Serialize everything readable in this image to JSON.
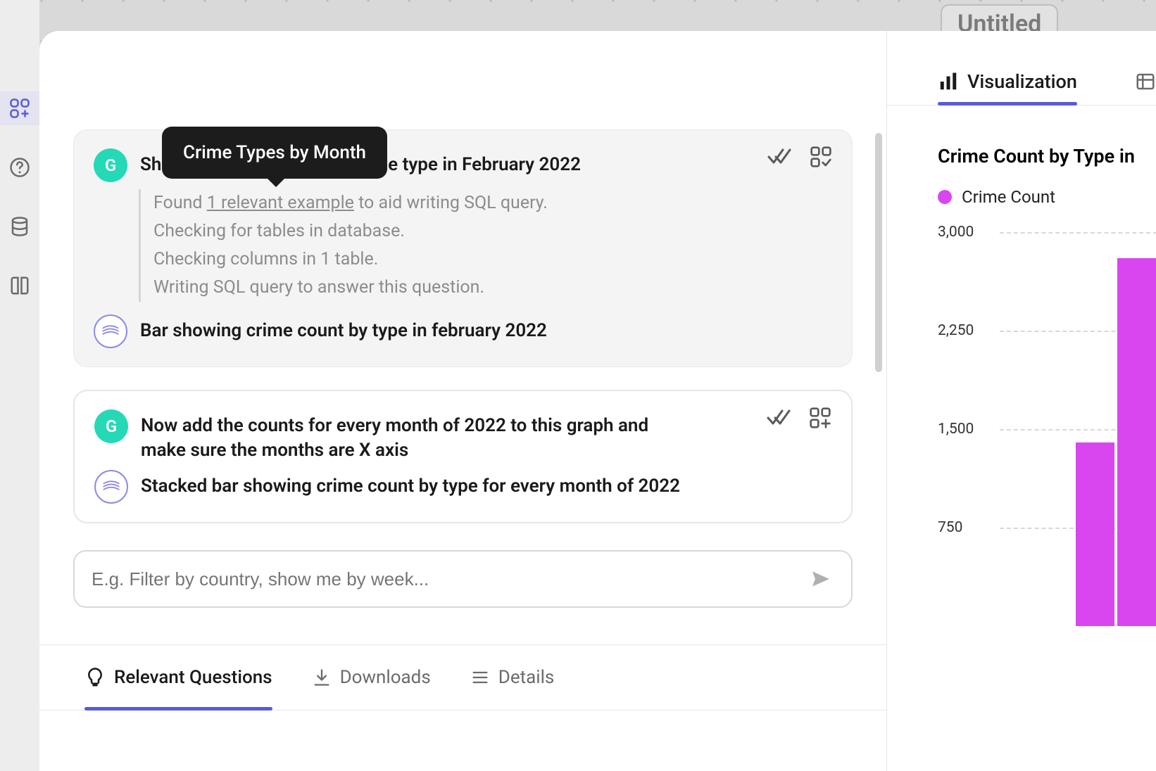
{
  "canvas": {
    "title": "Untitled"
  },
  "tooltip": "Crime Types by Month",
  "sidebar": {
    "items": [
      {
        "name": "apps-icon"
      },
      {
        "name": "help-icon"
      },
      {
        "name": "database-icon"
      },
      {
        "name": "docs-icon"
      }
    ]
  },
  "conversations": [
    {
      "user_initial": "G",
      "user_msg_prefix": "Sh",
      "user_msg_suffix": "crime type in February 2022",
      "steps_prefix": "Found ",
      "steps_link": "1 relevant example",
      "steps_suffix": " to aid writing SQL query.",
      "step2": "Checking for tables in database.",
      "step3": "Checking columns in 1 table.",
      "step4": "Writing SQL query to answer this question.",
      "ai_msg": "Bar showing crime count by type in february 2022"
    },
    {
      "user_initial": "G",
      "user_msg": "Now add the counts for every month of 2022 to this graph and make sure the months are X axis",
      "ai_msg": "Stacked bar showing crime count by type for every month of 2022"
    }
  ],
  "query_input": {
    "placeholder": "E.g. Filter by country, show me by week..."
  },
  "bottom_tabs": {
    "relevant": "Relevant Questions",
    "downloads": "Downloads",
    "details": "Details"
  },
  "vis_tabs": {
    "visualization": "Visualization"
  },
  "chart": {
    "title": "Crime Count by Type in",
    "legend": "Crime Count",
    "y_ticks": [
      "3,000",
      "2,250",
      "1,500",
      "750"
    ]
  },
  "chart_data": {
    "type": "bar",
    "title": "Crime Count by Type in",
    "ylabel": "Crime Count",
    "ylim": [
      0,
      3000
    ],
    "legend_position": "top-left",
    "series": [
      {
        "name": "Crime Count",
        "color": "#d946ef"
      }
    ],
    "partial_bars_visible": [
      {
        "approx_height": 1400
      },
      {
        "approx_height": 2800
      }
    ],
    "note": "Chart is clipped by viewport; x categories not visible."
  }
}
